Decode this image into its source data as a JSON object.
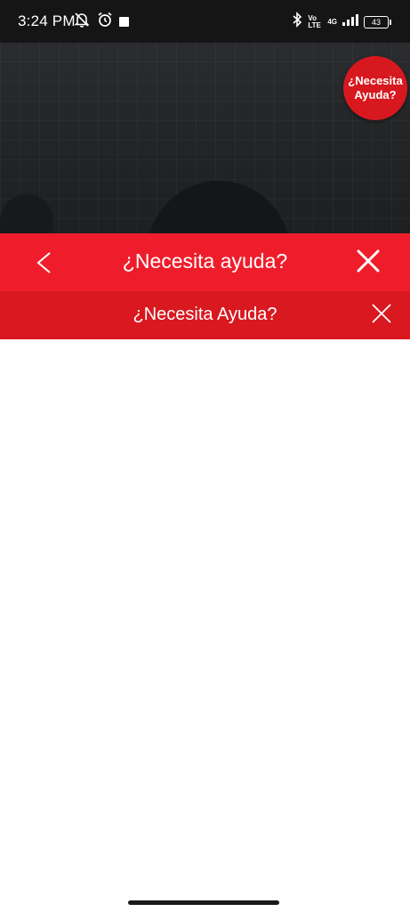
{
  "status_bar": {
    "time": "3:24 PM",
    "volte": "Vo LTE",
    "network": "4G",
    "battery": "43"
  },
  "bubble": {
    "line1": "¿Necesita",
    "line2": "Ayuda?"
  },
  "header": {
    "title": "¿Necesita ayuda?"
  },
  "subheader": {
    "title": "¿Necesita Ayuda?"
  },
  "colors": {
    "header_red": "#ef1d2b",
    "subheader_red": "#d9181f",
    "bubble_red": "#d7191f"
  }
}
